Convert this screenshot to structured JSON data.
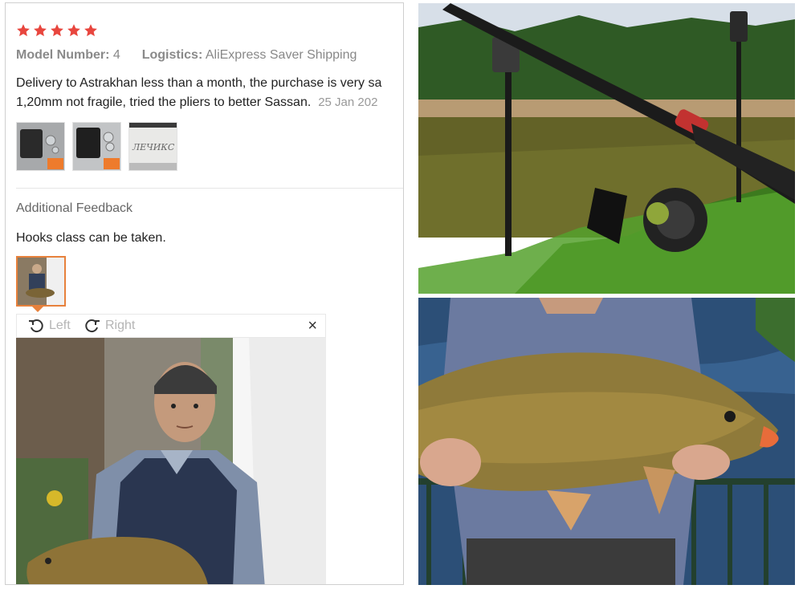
{
  "review": {
    "rating": 5,
    "model_label": "Model Number:",
    "model_value": "4",
    "logistics_label": "Logistics:",
    "logistics_value": "AliExpress Saver Shipping",
    "text_line1": "Delivery to Astrakhan less than a month, the purchase is very sa",
    "text_line2": "1,20mm not fragile, tried the pliers to better Sassan.",
    "date": "25 Jan 202",
    "thumb_label": "ЛЕЧИКС"
  },
  "additional": {
    "title": "Additional Feedback",
    "text": "Hooks class can be taken."
  },
  "viewer": {
    "rotate_left": "Left",
    "rotate_right": "Right",
    "close": "×"
  },
  "colors": {
    "star": "#e8463e",
    "selected_border": "#e7813c",
    "muted_text": "#888888"
  },
  "icons": [
    "star-icon",
    "rotate-left-icon",
    "rotate-right-icon",
    "close-icon"
  ]
}
